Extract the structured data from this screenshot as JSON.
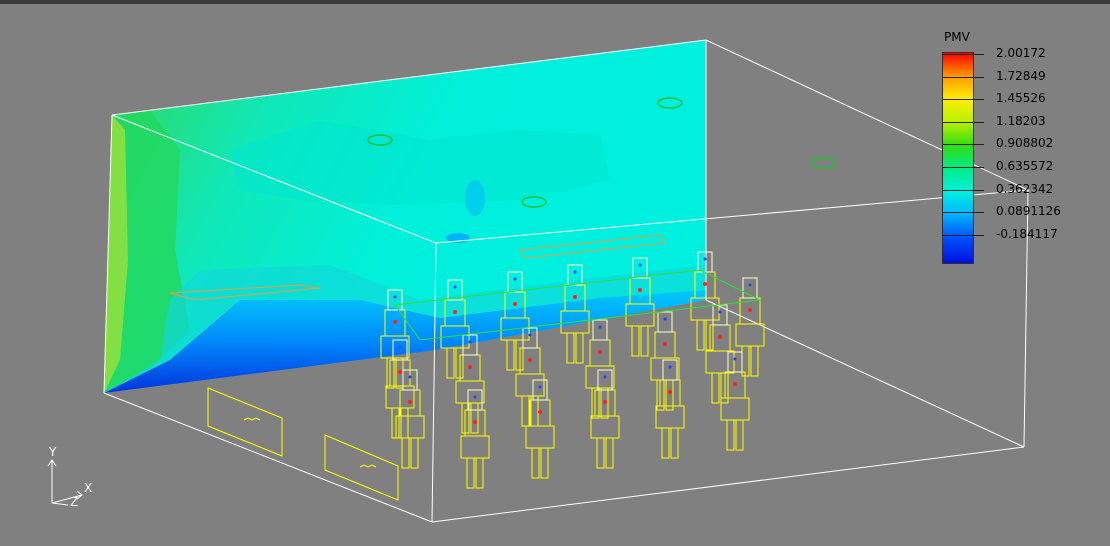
{
  "legend": {
    "title": "PMV",
    "values": [
      "2.00172",
      "1.72849",
      "1.45526",
      "1.18203",
      "0.908802",
      "0.635572",
      "0.362342",
      "0.0891126",
      "-0.184117"
    ]
  },
  "axes": {
    "y": "Y",
    "x": "X",
    "z": "Z"
  },
  "colors": {
    "background": "#808080",
    "wireframe": "#ffffff",
    "occupant_outline": "#ffff00",
    "pmv_max": "#ff0000",
    "pmv_min": "#0010dd"
  }
}
